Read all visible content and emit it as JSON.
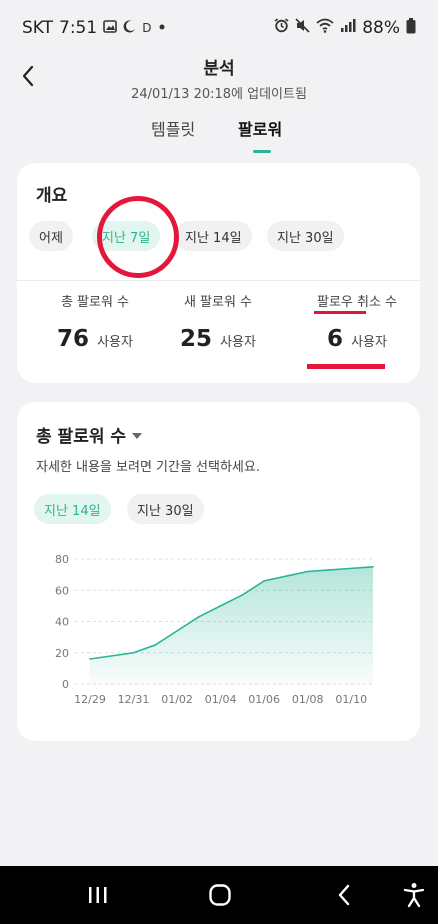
{
  "status_bar": {
    "carrier": "SKT",
    "time": "7:51",
    "left_icons": [
      "gallery-icon",
      "moon-icon",
      "d-icon",
      "dot-icon"
    ],
    "d_label": "D",
    "right_icons": [
      "alarm-icon",
      "mute-icon",
      "wifi-icon",
      "signal-icon",
      "battery-icon"
    ],
    "battery": "88%"
  },
  "header": {
    "back_icon": "chevron-left-icon",
    "title": "분석",
    "subtitle": "24/01/13 20:18에 업데이트됨"
  },
  "tabs": [
    {
      "label": "템플릿",
      "active": false
    },
    {
      "label": "팔로워",
      "active": true
    }
  ],
  "overview": {
    "title": "개요",
    "filters": [
      {
        "label": "어제",
        "active": false
      },
      {
        "label": "지난 7일",
        "active": true
      },
      {
        "label": "지난 14일",
        "active": false
      },
      {
        "label": "지난 30일",
        "active": false
      }
    ],
    "stats": [
      {
        "label": "총 팔로워 수",
        "value": "76",
        "unit": "사용자"
      },
      {
        "label": "새 팔로워 수",
        "value": "25",
        "unit": "사용자"
      },
      {
        "label": "팔로우 취소 수",
        "value": "6",
        "unit": "사용자"
      }
    ]
  },
  "followers_chart": {
    "title": "총 팔로워 수",
    "description": "자세한 내용을 보려면 기간을 선택하세요.",
    "filters": [
      {
        "label": "지난 14일",
        "active": true
      },
      {
        "label": "지난 30일",
        "active": false
      }
    ]
  },
  "chart_data": {
    "type": "area",
    "title": "",
    "xlabel": "",
    "ylabel": "",
    "y_ticks": [
      "80",
      "60",
      "40",
      "20",
      "0"
    ],
    "ylim": [
      0,
      80
    ],
    "grid": true,
    "x_tick_labels": [
      "12/29",
      "12/31",
      "01/02",
      "01/04",
      "01/06",
      "01/08",
      "01/10"
    ],
    "x": [
      "12/29",
      "12/30",
      "12/31",
      "01/01",
      "01/02",
      "01/03",
      "01/04",
      "01/05",
      "01/06",
      "01/07",
      "01/08",
      "01/09",
      "01/10",
      "01/11"
    ],
    "series": [
      {
        "values": [
          16,
          18,
          20,
          25,
          34,
          43,
          50,
          57,
          66,
          69,
          72,
          73,
          74,
          75
        ]
      }
    ],
    "color": "#2bb597"
  },
  "nav_bar": {
    "buttons": [
      "recent-apps-icon",
      "home-icon",
      "back-icon",
      "accessibility-icon"
    ]
  },
  "colors": {
    "accent": "#2bb597",
    "annotation": "#e5163b"
  }
}
